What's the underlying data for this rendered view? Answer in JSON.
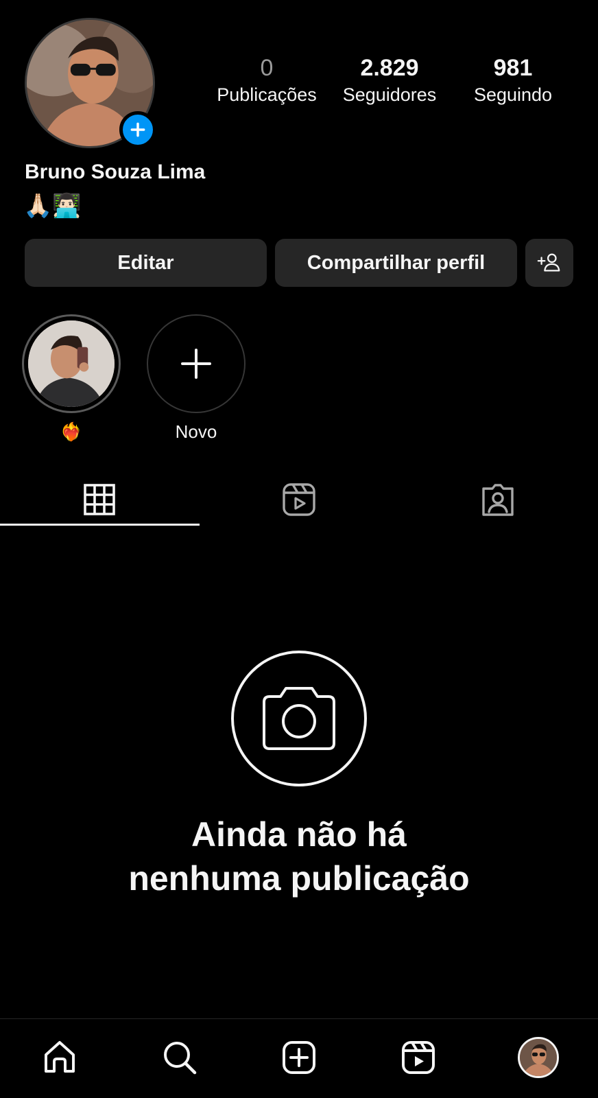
{
  "profile": {
    "name": "Bruno Souza Lima",
    "bio": "🙏🏻👨🏻‍💻"
  },
  "stats": [
    {
      "value": "0",
      "label": "Publicações"
    },
    {
      "value": "2.829",
      "label": "Seguidores"
    },
    {
      "value": "981",
      "label": "Seguindo"
    }
  ],
  "buttons": {
    "edit_label": "Editar",
    "share_label": "Compartilhar perfil"
  },
  "highlights": [
    {
      "label": "❤️‍🔥",
      "icon": "story-photo"
    },
    {
      "label": "Novo",
      "icon": "plus-icon"
    }
  ],
  "tabs": [
    {
      "icon": "grid-icon",
      "active": true
    },
    {
      "icon": "reels-icon",
      "active": false
    },
    {
      "icon": "tagged-icon",
      "active": false
    }
  ],
  "empty_state": {
    "line1": "Ainda não há",
    "line2": "nenhuma publicação",
    "icon": "camera-icon"
  },
  "bottom_nav": [
    "home-icon",
    "search-icon",
    "create-icon",
    "reels-icon",
    "profile-avatar"
  ],
  "colors": {
    "background": "#000000",
    "button_bg": "#262626",
    "accent_blue": "#0095f6",
    "text": "#f5f5f5"
  }
}
